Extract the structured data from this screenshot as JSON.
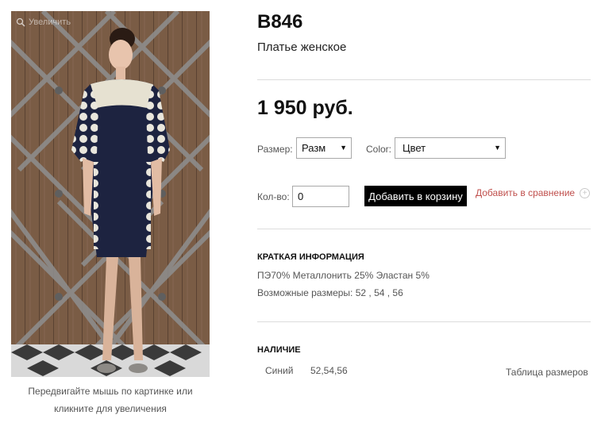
{
  "product": {
    "sku": "B846",
    "name": "Платье женское",
    "price": "1 950 руб.",
    "image_caption": "Передвигайте мышь по картинке или кликните для увеличения",
    "zoom_hint": "Увеличить"
  },
  "options": {
    "size_label": "Размер:",
    "size_value": "Разм",
    "color_label": "Color:",
    "color_value": "Цвет"
  },
  "purchase": {
    "qty_label": "Кол-во:",
    "qty_value": "0",
    "add_to_cart_label": "Добавить в корзину",
    "compare_label": "Добавить в сравнение"
  },
  "summary": {
    "title": "КРАТКАЯ ИНФОРМАЦИЯ",
    "composition": "ПЭ70% Металлонить 25% Эластан 5%",
    "sizes": "Возможные размеры: 52 , 54 , 56"
  },
  "availability": {
    "title": "НАЛИЧИЕ",
    "rows": [
      {
        "color": "Синий",
        "sizes": "52,54,56"
      }
    ],
    "size_table_link": "Таблица размеров"
  },
  "colors": {
    "accent_link": "#c0504d",
    "button_bg": "#000000",
    "divider": "#dcdcdc"
  },
  "icons": {
    "zoom": "magnifier-icon",
    "compare": "plus-circle-icon",
    "select_arrow": "triangle-down-icon"
  }
}
